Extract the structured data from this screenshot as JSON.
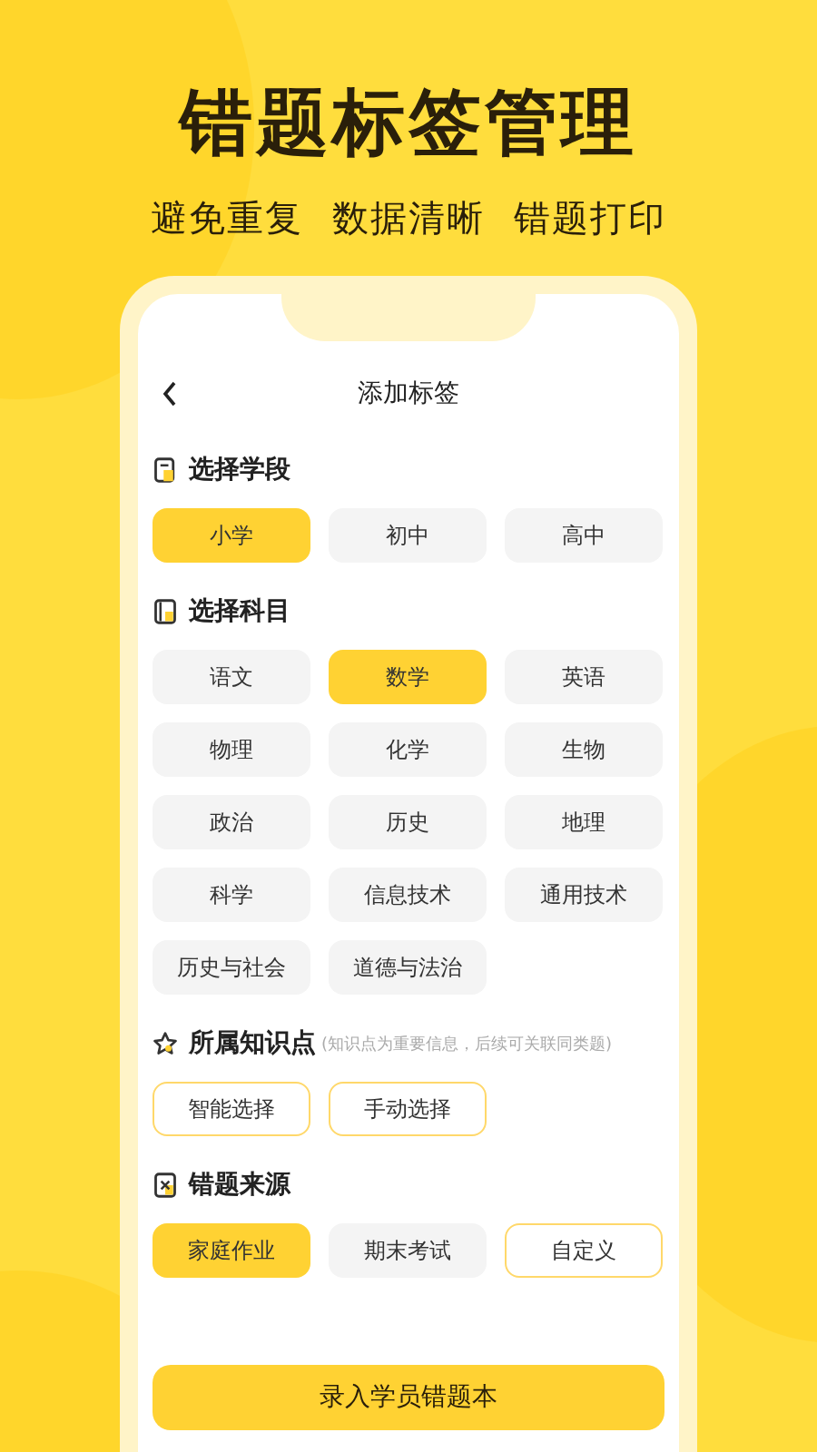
{
  "headline": "错题标签管理",
  "subtitle": [
    "避免重复",
    "数据清晰",
    "错题打印"
  ],
  "screen": {
    "title": "添加标签",
    "sections": [
      {
        "kind": "document",
        "title": "选择学段",
        "chips": [
          {
            "label": "小学",
            "selected": true,
            "kind": "choice"
          },
          {
            "label": "初中",
            "selected": false,
            "kind": "choice"
          },
          {
            "label": "高中",
            "selected": false,
            "kind": "choice"
          }
        ]
      },
      {
        "kind": "book",
        "title": "选择科目",
        "chips": [
          {
            "label": "语文",
            "selected": false,
            "kind": "choice"
          },
          {
            "label": "数学",
            "selected": true,
            "kind": "choice"
          },
          {
            "label": "英语",
            "selected": false,
            "kind": "choice"
          },
          {
            "label": "物理",
            "selected": false,
            "kind": "choice"
          },
          {
            "label": "化学",
            "selected": false,
            "kind": "choice"
          },
          {
            "label": "生物",
            "selected": false,
            "kind": "choice"
          },
          {
            "label": "政治",
            "selected": false,
            "kind": "choice"
          },
          {
            "label": "历史",
            "selected": false,
            "kind": "choice"
          },
          {
            "label": "地理",
            "selected": false,
            "kind": "choice"
          },
          {
            "label": "科学",
            "selected": false,
            "kind": "choice"
          },
          {
            "label": "信息技术",
            "selected": false,
            "kind": "choice"
          },
          {
            "label": "通用技术",
            "selected": false,
            "kind": "choice"
          },
          {
            "label": "历史与社会",
            "selected": false,
            "kind": "choice"
          },
          {
            "label": "道德与法治",
            "selected": false,
            "kind": "choice"
          }
        ]
      },
      {
        "kind": "star",
        "title": "所属知识点",
        "hint": "(知识点为重要信息，后续可关联同类题)",
        "chips": [
          {
            "label": "智能选择",
            "selected": false,
            "kind": "outline"
          },
          {
            "label": "手动选择",
            "selected": false,
            "kind": "outline"
          }
        ]
      },
      {
        "kind": "cross",
        "title": "错题来源",
        "chips": [
          {
            "label": "家庭作业",
            "selected": true,
            "kind": "choice"
          },
          {
            "label": "期末考试",
            "selected": false,
            "kind": "choice"
          },
          {
            "label": "自定义",
            "selected": false,
            "kind": "outline"
          }
        ]
      }
    ],
    "submit": "录入学员错题本"
  }
}
